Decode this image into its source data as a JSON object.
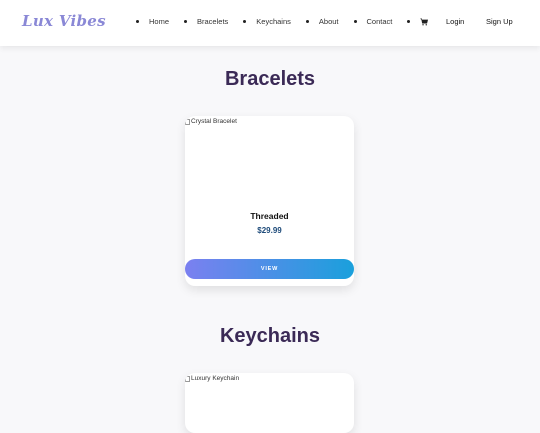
{
  "brand": {
    "logo_text": "Lux Vibes"
  },
  "nav": {
    "items": [
      "Home",
      "Bracelets",
      "Keychains",
      "About",
      "Contact"
    ],
    "cart_icon": "cart-icon"
  },
  "auth": {
    "login": "Login",
    "signup": "Sign Up"
  },
  "sections": [
    {
      "title": "Bracelets",
      "product": {
        "image_alt": "Crystal Bracelet",
        "name": "Threaded",
        "price": "$29.99",
        "button": "VIEW"
      }
    },
    {
      "title": "Keychains",
      "product": {
        "image_alt": "Luxury Keychain"
      }
    }
  ],
  "colors": {
    "logo": "#8a88d6",
    "title": "#3b2a56",
    "price": "#1e4b7a",
    "button_gradient_start": "#7b80f0",
    "button_gradient_end": "#1aa0dc"
  }
}
